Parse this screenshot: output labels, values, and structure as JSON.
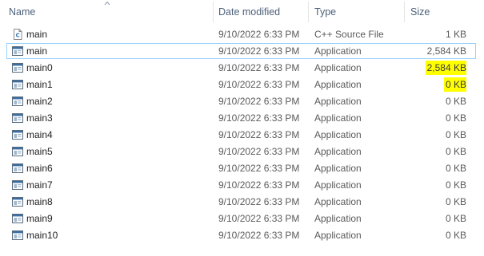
{
  "columns": {
    "name": "Name",
    "date": "Date modified",
    "type": "Type",
    "size": "Size"
  },
  "highlight_color": "#ffff00",
  "rows": [
    {
      "name": "main",
      "date": "9/10/2022 6:33 PM",
      "type": "C++ Source File",
      "size": "1 KB",
      "icon": "cpp-source-file-icon",
      "selected": false,
      "highlighted": false
    },
    {
      "name": "main",
      "date": "9/10/2022 6:33 PM",
      "type": "Application",
      "size": "2,584 KB",
      "icon": "application-icon",
      "selected": true,
      "highlighted": false
    },
    {
      "name": "main0",
      "date": "9/10/2022 6:33 PM",
      "type": "Application",
      "size": "2,584 KB",
      "icon": "application-icon",
      "selected": false,
      "highlighted": true
    },
    {
      "name": "main1",
      "date": "9/10/2022 6:33 PM",
      "type": "Application",
      "size": "0 KB",
      "icon": "application-icon",
      "selected": false,
      "highlighted": true
    },
    {
      "name": "main2",
      "date": "9/10/2022 6:33 PM",
      "type": "Application",
      "size": "0 KB",
      "icon": "application-icon",
      "selected": false,
      "highlighted": false
    },
    {
      "name": "main3",
      "date": "9/10/2022 6:33 PM",
      "type": "Application",
      "size": "0 KB",
      "icon": "application-icon",
      "selected": false,
      "highlighted": false
    },
    {
      "name": "main4",
      "date": "9/10/2022 6:33 PM",
      "type": "Application",
      "size": "0 KB",
      "icon": "application-icon",
      "selected": false,
      "highlighted": false
    },
    {
      "name": "main5",
      "date": "9/10/2022 6:33 PM",
      "type": "Application",
      "size": "0 KB",
      "icon": "application-icon",
      "selected": false,
      "highlighted": false
    },
    {
      "name": "main6",
      "date": "9/10/2022 6:33 PM",
      "type": "Application",
      "size": "0 KB",
      "icon": "application-icon",
      "selected": false,
      "highlighted": false
    },
    {
      "name": "main7",
      "date": "9/10/2022 6:33 PM",
      "type": "Application",
      "size": "0 KB",
      "icon": "application-icon",
      "selected": false,
      "highlighted": false
    },
    {
      "name": "main8",
      "date": "9/10/2022 6:33 PM",
      "type": "Application",
      "size": "0 KB",
      "icon": "application-icon",
      "selected": false,
      "highlighted": false
    },
    {
      "name": "main9",
      "date": "9/10/2022 6:33 PM",
      "type": "Application",
      "size": "0 KB",
      "icon": "application-icon",
      "selected": false,
      "highlighted": false
    },
    {
      "name": "main10",
      "date": "9/10/2022 6:33 PM",
      "type": "Application",
      "size": "0 KB",
      "icon": "application-icon",
      "selected": false,
      "highlighted": false
    }
  ]
}
